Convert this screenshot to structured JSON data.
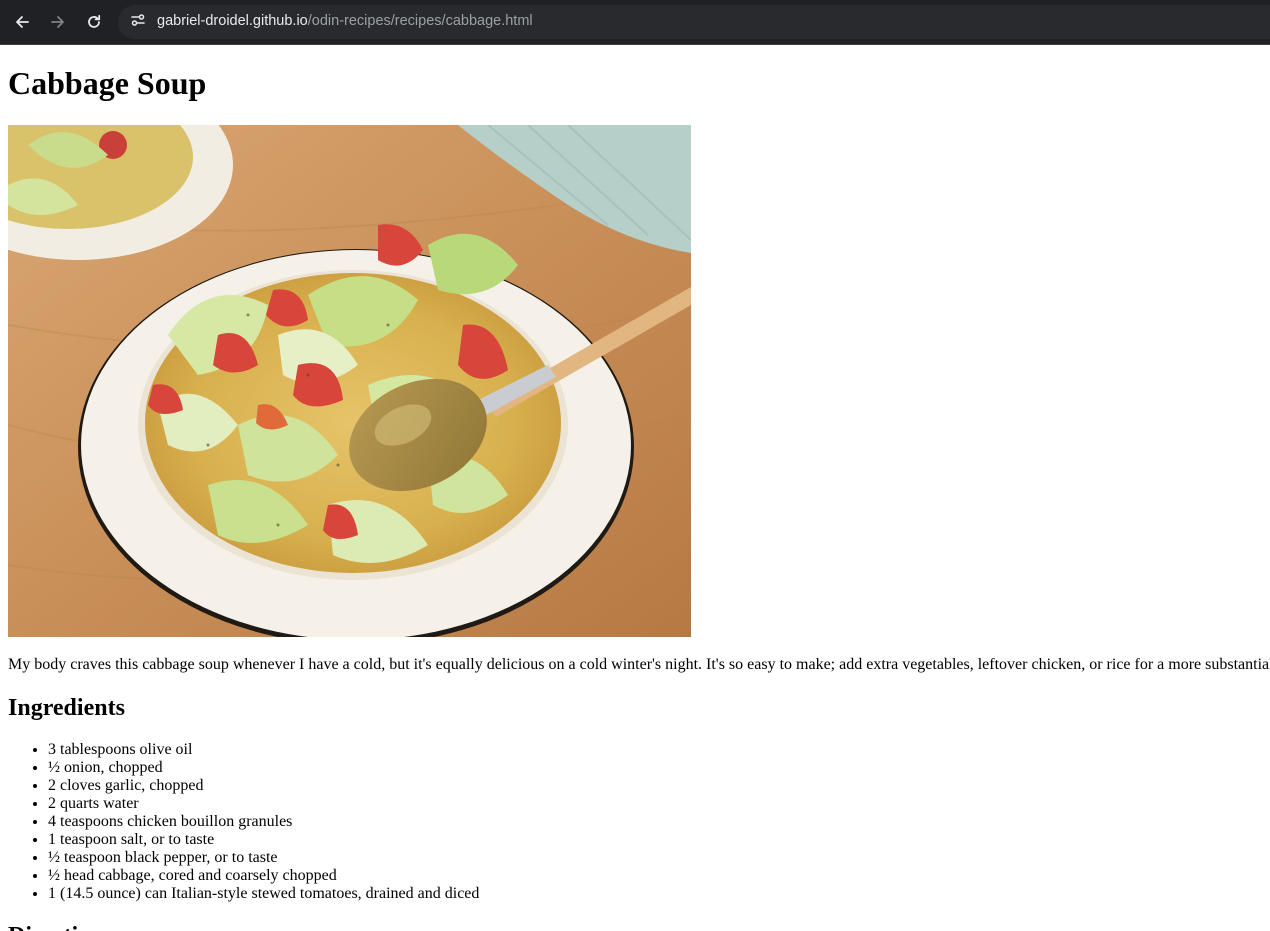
{
  "browser": {
    "url_host": "gabriel-droidel.github.io",
    "url_path": "/odin-recipes/recipes/cabbage.html",
    "icons": [
      "back-arrow-icon",
      "forward-arrow-icon",
      "reload-icon",
      "site-info-icon"
    ]
  },
  "page": {
    "title": "Cabbage Soup",
    "intro": "My body craves this cabbage soup whenever I have a cold, but it's equally delicious on a cold winter's night. It's so easy to make; add extra vegetables, leftover chicken, or rice for a more substantial",
    "ingredients_heading": "Ingredients",
    "ingredients": [
      "3 tablespoons olive oil",
      "½ onion, chopped",
      "2 cloves garlic, chopped",
      "2 quarts water",
      "4 teaspoons chicken bouillon granules",
      "1 teaspoon salt, or to taste",
      "½ teaspoon black pepper, or to taste",
      "½ head cabbage, cored and coarsely chopped",
      "1 (14.5 ounce) can Italian-style stewed tomatoes, drained and diced"
    ],
    "directions_heading": "Directions"
  },
  "colors": {
    "toolbar_bg": "#202124",
    "omnibox_bg": "#282a2d",
    "url_host": "#e8eaed",
    "url_path": "#9aa0a6"
  }
}
